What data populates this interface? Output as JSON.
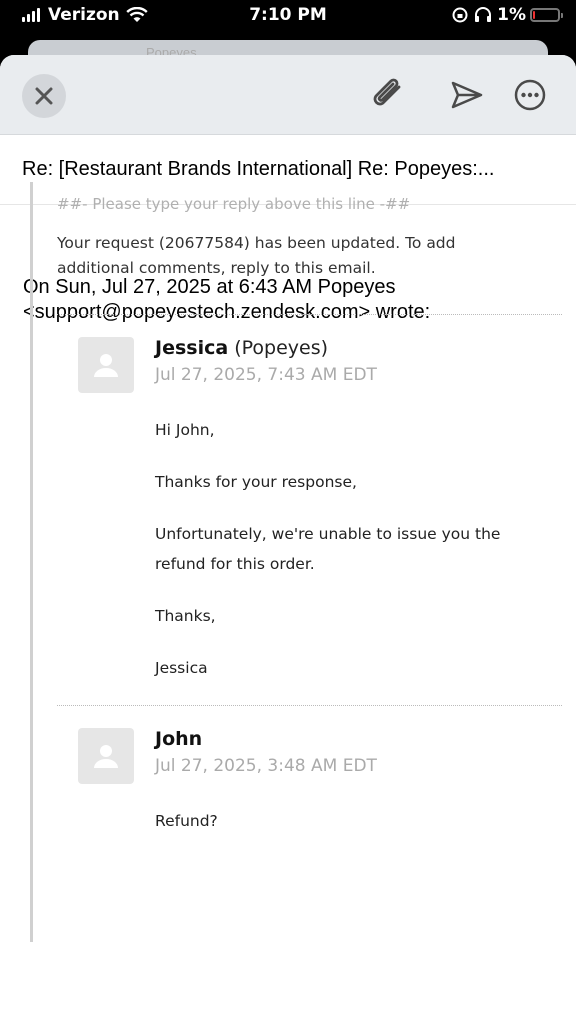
{
  "status_bar": {
    "carrier": "Verizon",
    "time": "7:10 PM",
    "battery": "1%"
  },
  "background_card": {
    "text": "Popeyes"
  },
  "subject": "Re: [Restaurant Brands International] Re: Popeyes:...",
  "wrote_line_1": "On Sun, Jul 27, 2025 at 6:43 AM Popeyes",
  "wrote_line_2": "<support@popeyestech.zendesk.com> wrote:",
  "quote": {
    "hint": "##- Please type your reply above this line -##",
    "updated_1": "Your request (20677584) has been updated. To add",
    "updated_2": "additional comments, reply to this email."
  },
  "comments": [
    {
      "name": "Jessica",
      "org": "(Popeyes)",
      "time": "Jul 27, 2025, 7:43 AM EDT",
      "lines": [
        "Hi John,",
        "Thanks for your response,",
        "Unfortunately, we're unable to issue you the",
        "refund for this order.",
        "Thanks,",
        "Jessica"
      ]
    },
    {
      "name": "John",
      "time": "Jul 27, 2025, 3:48 AM EDT",
      "lines": [
        "Refund?"
      ]
    }
  ],
  "icons": [
    "close-icon",
    "paperclip-icon",
    "send-icon",
    "more-icon",
    "avatar-icon"
  ]
}
